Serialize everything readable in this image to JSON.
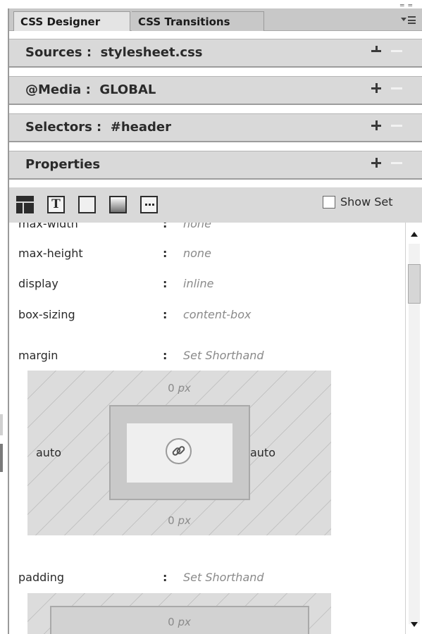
{
  "tabs": [
    {
      "label": "CSS Designer",
      "active": true
    },
    {
      "label": "CSS Transitions",
      "active": false
    }
  ],
  "sections": [
    {
      "label": "Sources :  stylesheet.css"
    },
    {
      "label": "@Media :  GLOBAL"
    },
    {
      "label": "Selectors :  #header"
    },
    {
      "label": "Properties"
    }
  ],
  "toolbar": {
    "icons": [
      "layout-icon",
      "text-icon",
      "border-icon",
      "background-icon",
      "more-icon"
    ],
    "text_icon_glyph": "T",
    "show_set_label": "Show Set",
    "show_set_checked": false
  },
  "properties": [
    {
      "name": "max-width",
      "colon": ":",
      "value": "none"
    },
    {
      "name": "max-height",
      "colon": ":",
      "value": "none"
    },
    {
      "name": "display",
      "colon": ":",
      "value": "inline"
    },
    {
      "name": "box-sizing",
      "colon": ":",
      "value": "content-box"
    },
    {
      "name": "margin",
      "colon": ":",
      "value": "Set Shorthand"
    },
    {
      "name": "padding",
      "colon": ":",
      "value": "Set Shorthand"
    }
  ],
  "margin_box": {
    "top": {
      "num": "0",
      "unit": "px"
    },
    "bottom": {
      "num": "0",
      "unit": "px"
    },
    "left": "auto",
    "right": "auto"
  },
  "padding_box": {
    "top": {
      "num": "0",
      "unit": "px"
    }
  },
  "colors": {
    "panel_header": "#d9d9d9",
    "tab_bar": "#c8c8c8",
    "value_text": "#8a8a8a"
  }
}
